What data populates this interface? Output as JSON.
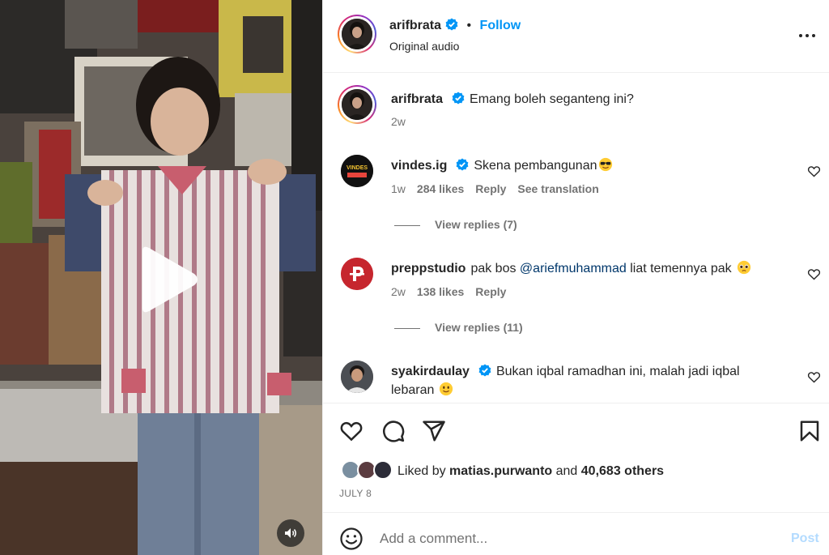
{
  "post": {
    "author": "arifbrata",
    "follow_label": "Follow",
    "separator": "•",
    "audio": "Original audio",
    "caption": "Emang boleh seganteng ini?",
    "caption_age": "2w"
  },
  "comments": [
    {
      "user": "vindes.ig",
      "verified": true,
      "text": "Skena pembangunan",
      "emoji": "smiling-face-with-sunglasses",
      "age": "1w",
      "likes": "284 likes",
      "reply": "Reply",
      "translate": "See translation",
      "view_replies": "View replies (7)",
      "avatar_color": "#111111"
    },
    {
      "user": "preppstudio",
      "verified": false,
      "text_before": "pak bos ",
      "mention": "@ariefmuhammad",
      "text_after": " liat temennya pak",
      "emoji": "pleading-face",
      "age": "2w",
      "likes": "138 likes",
      "reply": "Reply",
      "view_replies": "View replies (11)",
      "avatar_color": "#c6262e"
    },
    {
      "user": "syakirdaulay",
      "verified": true,
      "text": "Bukan iqbal ramadhan ini, malah jadi iqbal lebaran",
      "emoji": "slightly-smiling-face",
      "avatar_color": "#3a3a3a"
    }
  ],
  "likes": {
    "prefix": "Liked by ",
    "user": "matias.purwanto",
    "middle": " and ",
    "others": "40,683 others"
  },
  "date": "JULY 8",
  "composer": {
    "placeholder": "Add a comment...",
    "post_label": "Post"
  },
  "colors": {
    "accent": "#0095f6",
    "post_disabled": "#b3dbff",
    "verified": "#0095f6",
    "secondary_text": "#737373"
  },
  "icons": [
    "play-icon",
    "volume-icon",
    "more-icon",
    "verified-icon",
    "heart-icon",
    "comment-icon",
    "share-icon",
    "bookmark-icon",
    "emoji-icon"
  ]
}
